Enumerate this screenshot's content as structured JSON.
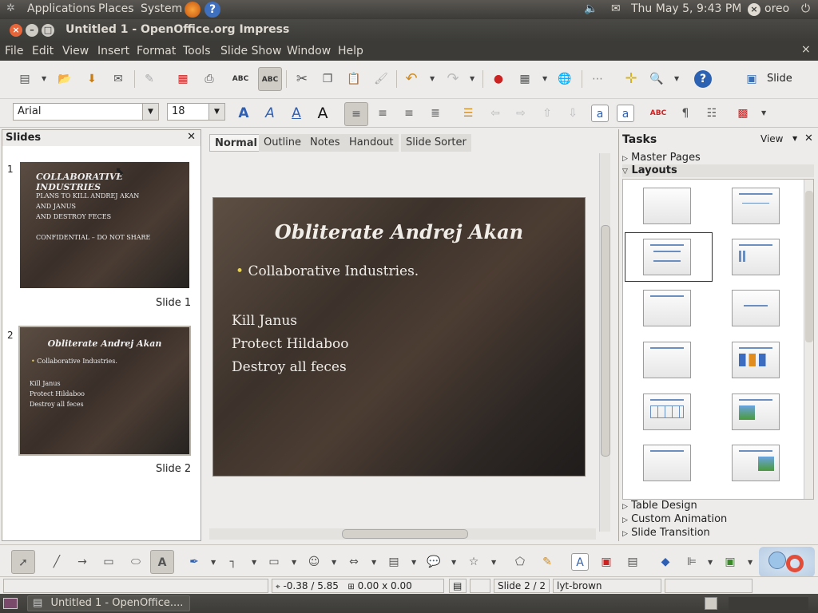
{
  "topbar": {
    "applications": "Applications",
    "places": "Places",
    "system": "System",
    "datetime": "Thu May  5,  9:43 PM",
    "user": "oreo"
  },
  "window": {
    "title": "Untitled 1 - OpenOffice.org Impress"
  },
  "menu": [
    "File",
    "Edit",
    "View",
    "Insert",
    "Format",
    "Tools",
    "Slide Show",
    "Window",
    "Help"
  ],
  "toolbar": {
    "slide_label": "Slide"
  },
  "format": {
    "font": "Arial",
    "size": "18"
  },
  "slides_panel": {
    "title": "Slides",
    "slides": [
      {
        "num": "1",
        "label": "Slide 1",
        "title": "COLLABORATIVE INDUSTRIES",
        "lines": [
          "PLANS TO KILL ANDREJ AKAN",
          "AND JANUS",
          "AND DESTROY FECES",
          "",
          "CONFIDENTIAL – DO NOT SHARE"
        ]
      },
      {
        "num": "2",
        "label": "Slide 2",
        "title": "Obliterate Andrej Akan",
        "bullet": "Collaborative Industries.",
        "lines": [
          "Kill Janus",
          "Protect Hildaboo",
          "Destroy all feces"
        ]
      }
    ]
  },
  "tabs": [
    "Normal",
    "Outline",
    "Notes",
    "Handout",
    "Slide Sorter"
  ],
  "current_slide": {
    "title": "Obliterate Andrej Akan",
    "bullet": "Collaborative Industries.",
    "lines": [
      "Kill Janus",
      "Protect Hildaboo",
      "Destroy all feces"
    ]
  },
  "tasks": {
    "title": "Tasks",
    "view": "View",
    "sections": {
      "master": "Master Pages",
      "layouts": "Layouts",
      "table": "Table Design",
      "anim": "Custom Animation",
      "trans": "Slide Transition"
    }
  },
  "status": {
    "position": "-0.38 / 5.85",
    "size": "0.00 x 0.00",
    "slide": "Slide 2 / 2",
    "master": "lyt-brown"
  },
  "taskbar": {
    "item": "Untitled 1 - OpenOffice...."
  }
}
